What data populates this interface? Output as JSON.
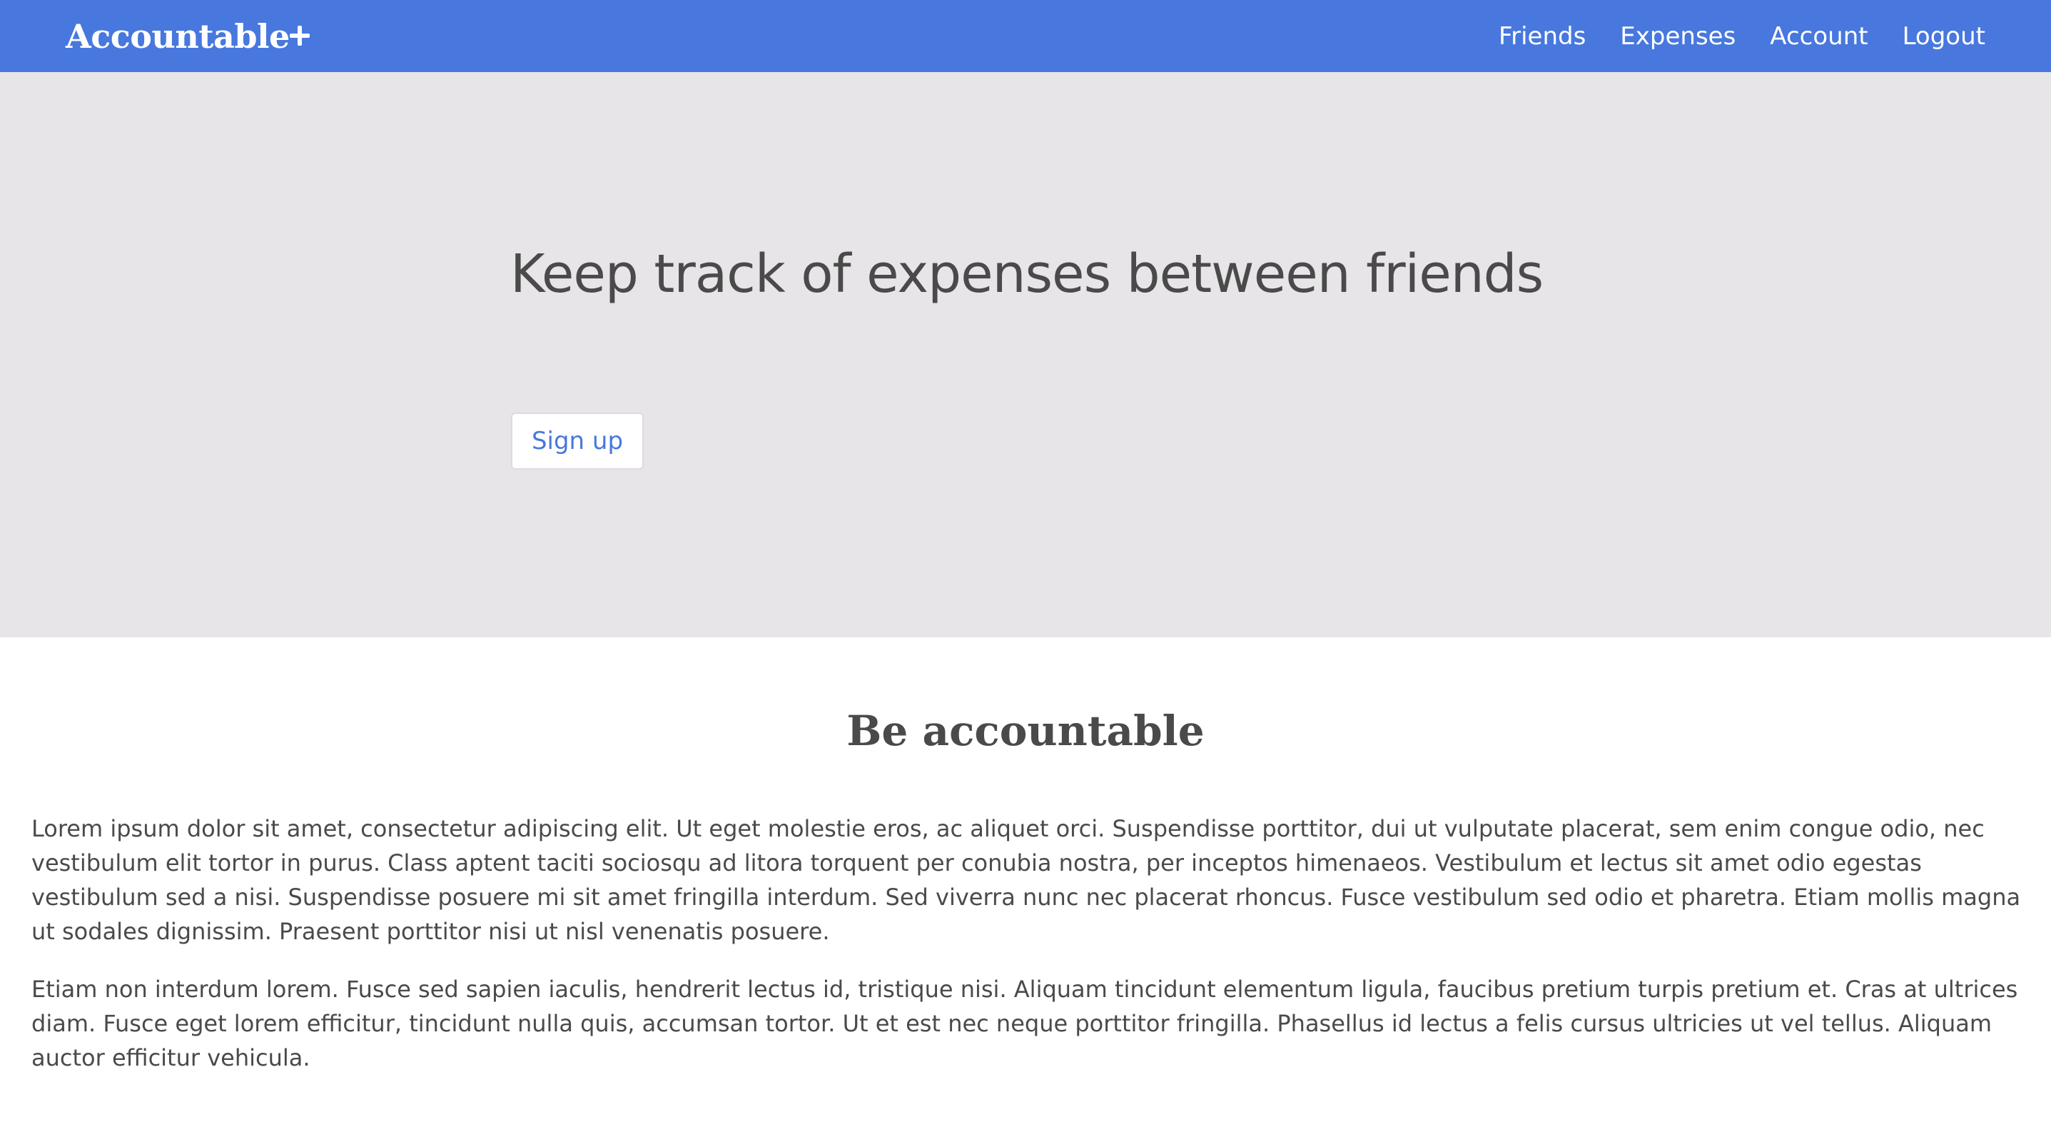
{
  "navbar": {
    "brand": "Accountable",
    "add_icon": "plus-icon",
    "links": [
      "Friends",
      "Expenses",
      "Account",
      "Logout"
    ]
  },
  "hero": {
    "title": "Keep track of expenses between friends",
    "signup_label": "Sign up"
  },
  "about": {
    "title": "Be accountable",
    "paragraphs": [
      "Lorem ipsum dolor sit amet, consectetur adipiscing elit. Ut eget molestie eros, ac aliquet orci. Suspendisse porttitor, dui ut vulputate placerat, sem enim congue odio, nec vestibulum elit tortor in purus. Class aptent taciti sociosqu ad litora torquent per conubia nostra, per inceptos himenaeos. Vestibulum et lectus sit amet odio egestas vestibulum sed a nisi. Suspendisse posuere mi sit amet fringilla interdum. Sed viverra nunc nec placerat rhoncus. Fusce vestibulum sed odio et pharetra. Etiam mollis magna ut sodales dignissim. Praesent porttitor nisi ut nisl venenatis posuere.",
      "Etiam non interdum lorem. Fusce sed sapien iaculis, hendrerit lectus id, tristique nisi. Aliquam tincidunt elementum ligula, faucibus pretium turpis pretium et. Cras at ultrices diam. Fusce eget lorem efficitur, tincidunt nulla quis, accumsan tortor. Ut et est nec neque porttitor fringilla. Phasellus id lectus a felis cursus ultricies ut vel tellus. Aliquam auctor efficitur vehicula."
    ]
  },
  "colors": {
    "navbar": "#4878de",
    "hero_bg": "#e8e5e8",
    "text": "#4a4a4a",
    "accent": "#4878de"
  }
}
